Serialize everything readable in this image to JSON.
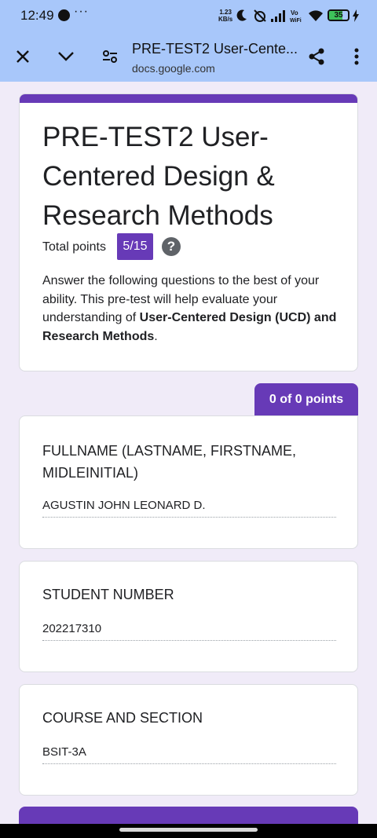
{
  "status_bar": {
    "time": "12:49",
    "net_speed_value": "1.23",
    "net_speed_unit": "KB/s",
    "battery_level": "35"
  },
  "toolbar": {
    "title": "PRE-TEST2 User-Cente...",
    "url": "docs.google.com"
  },
  "form": {
    "title": "PRE-TEST2 User-Centered Design & Research Methods",
    "total_points_label": "Total points",
    "total_points_value": "5/15",
    "description_intro": " Answer the following questions to the best of your ability. This pre-test will help evaluate your understanding of ",
    "description_bold": "User-Centered Design (UCD) and Research Methods",
    "description_end": "."
  },
  "section": {
    "points_label": "0 of 0 points"
  },
  "questions": [
    {
      "title": "FULLNAME (LASTNAME, FIRSTNAME, MIDLEINITIAL)",
      "answer": "AGUSTIN JOHN LEONARD D."
    },
    {
      "title": "STUDENT NUMBER",
      "answer": "202217310"
    },
    {
      "title": "COURSE AND SECTION",
      "answer": "BSIT-3A"
    }
  ],
  "colors": {
    "accent": "#673ab7",
    "toolbar_bg": "#a8c7fa",
    "page_bg": "#f0ebf8"
  }
}
